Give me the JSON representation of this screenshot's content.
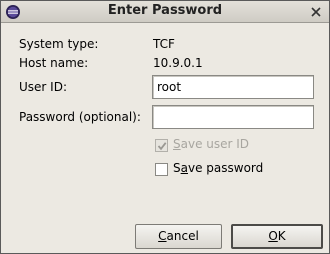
{
  "window": {
    "title": "Enter Password",
    "app_icon": "eclipse-icon",
    "close_icon": "close-icon"
  },
  "info": {
    "system_type_label": "System type:",
    "system_type_value": "TCF",
    "host_name_label": "Host name:",
    "host_name_value": "10.9.0.1"
  },
  "form": {
    "user_id_label": "User ID:",
    "user_id_value": "root",
    "password_label": "Password (optional):",
    "password_value": ""
  },
  "options": {
    "save_user_id": {
      "label_first": "S",
      "label_rest": "ave user ID",
      "checked": true,
      "enabled": false
    },
    "save_password": {
      "label_first": "S",
      "label_mnemonic": "a",
      "label_rest": "ve password",
      "checked": false,
      "enabled": true
    }
  },
  "buttons": {
    "cancel_mnemonic": "C",
    "cancel_rest": "ancel",
    "ok_mnemonic": "O",
    "ok_rest": "K"
  },
  "colors": {
    "dialog_bg": "#ece9e2",
    "disabled_text": "#a8a6a0"
  }
}
